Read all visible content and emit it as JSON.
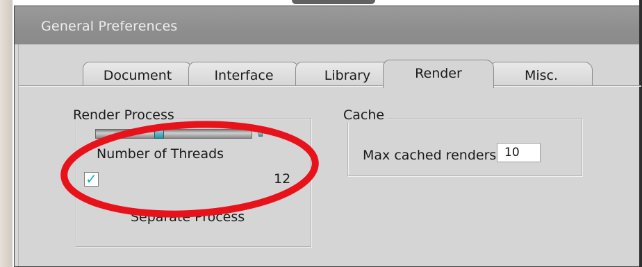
{
  "window": {
    "title": "General Preferences"
  },
  "tabs": [
    {
      "label": "Document",
      "active": false
    },
    {
      "label": "Interface",
      "active": false
    },
    {
      "label": "Library",
      "active": false
    },
    {
      "label": "Render",
      "active": true
    },
    {
      "label": "Misc.",
      "active": false
    }
  ],
  "render_process": {
    "group_title": "Render Process",
    "threads_label": "Number of Threads",
    "threads_value": "12",
    "slider_fraction": 0.4,
    "separate_process_label": "Separate Process",
    "separate_process_checked": true
  },
  "cache": {
    "group_title": "Cache",
    "max_cached_label": "Max cached renders",
    "max_cached_value": "10"
  },
  "colors": {
    "title_bar": "#8e8e8e",
    "panel_bg": "#d5d5d5",
    "accent": "#2b93a6",
    "highlight": "#e8121b"
  },
  "icons": {
    "check": "✓"
  }
}
